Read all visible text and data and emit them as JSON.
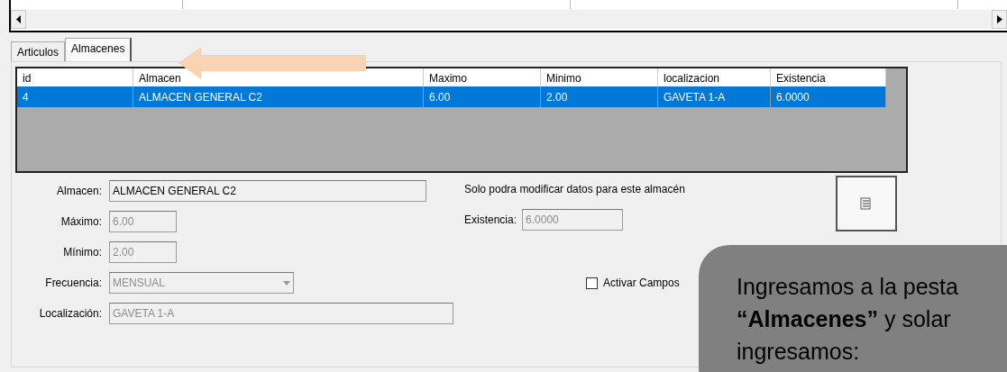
{
  "tabs": [
    {
      "label": "Articulos",
      "selected": false
    },
    {
      "label": "Almacenes",
      "selected": true
    }
  ],
  "grid": {
    "columns": [
      "id",
      "Almacen",
      "Maximo",
      "Minimo",
      "localizacion",
      "Existencia"
    ],
    "rows": [
      {
        "cells": [
          "4",
          "ALMACEN GENERAL C2",
          "6.00",
          "2.00",
          "GAVETA 1-A",
          "6.0000"
        ],
        "selected": true
      }
    ]
  },
  "form": {
    "fields": [
      {
        "label": "Almacen:",
        "value": "ALMACEN GENERAL C2",
        "kind": "text",
        "disabled": false
      },
      {
        "label": "Máximo:",
        "value": "6.00",
        "kind": "text",
        "disabled": true
      },
      {
        "label": "Mínimo:",
        "value": "2.00",
        "kind": "text",
        "disabled": true
      },
      {
        "label": "Frecuencia:",
        "value": "MENSUAL",
        "kind": "select",
        "disabled": true
      },
      {
        "label": "Localización:",
        "value": "GAVETA 1-A",
        "kind": "text",
        "disabled": true
      }
    ],
    "note": "Solo podra modificar datos para este almacén",
    "existencia": {
      "label": "Existencia:",
      "value": "6.0000",
      "disabled": true
    },
    "checkbox": {
      "label": "Activar Campos",
      "checked": false
    }
  },
  "callout": {
    "lines": [
      "Ingresamos a la pesta",
      "**“Almacenes”** y solar",
      "ingresamos:"
    ]
  }
}
